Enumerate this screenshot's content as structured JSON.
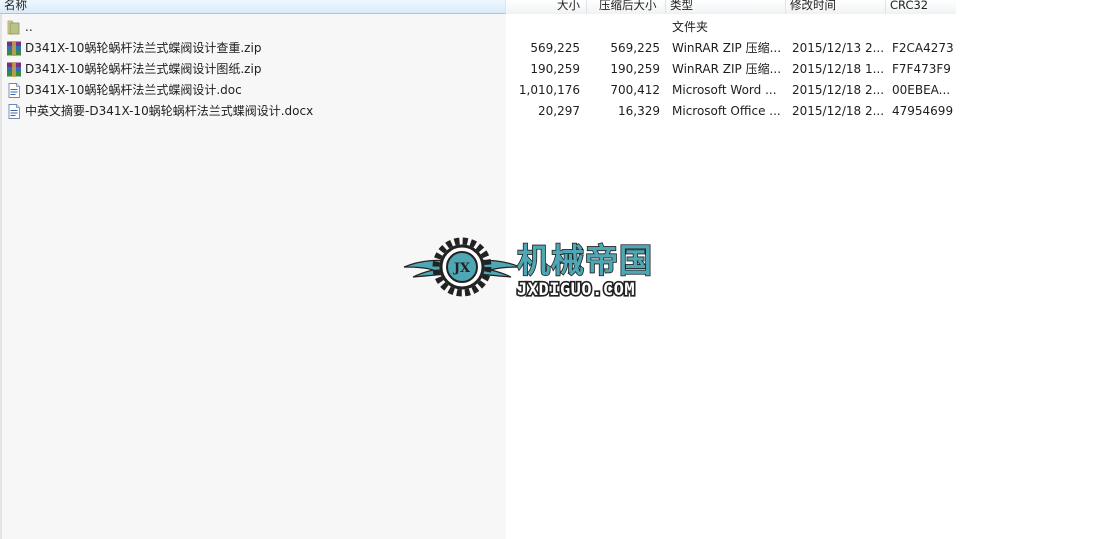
{
  "columns": {
    "name": "名称",
    "size": "大小",
    "packed": "压缩后大小",
    "type": "类型",
    "modified": "修改时间",
    "crc": "CRC32"
  },
  "rows": [
    {
      "icon": "folder-up-icon",
      "name": "..",
      "size": "",
      "packed": "",
      "type": "文件夹",
      "modified": "",
      "crc": ""
    },
    {
      "icon": "winrar-archive-icon",
      "name": "D341X-10蜗轮蜗杆法兰式蝶阀设计查重.zip",
      "size": "569,225",
      "packed": "569,225",
      "type": "WinRAR ZIP 压缩...",
      "modified": "2015/12/13 2...",
      "crc": "F2CA4273"
    },
    {
      "icon": "winrar-archive-icon",
      "name": "D341X-10蜗轮蜗杆法兰式蝶阀设计图纸.zip",
      "size": "190,259",
      "packed": "190,259",
      "type": "WinRAR ZIP 压缩...",
      "modified": "2015/12/18 1...",
      "crc": "F7F473F9"
    },
    {
      "icon": "word-document-icon",
      "name": "D341X-10蜗轮蜗杆法兰式蝶阀设计.doc",
      "size": "1,010,176",
      "packed": "700,412",
      "type": "Microsoft Word ...",
      "modified": "2015/12/18 2...",
      "crc": "00EBEA..."
    },
    {
      "icon": "word-document-icon",
      "name": "中英文摘要-D341X-10蜗轮蜗杆法兰式蝶阀设计.docx",
      "size": "20,297",
      "packed": "16,329",
      "type": "Microsoft Office ...",
      "modified": "2015/12/18 2...",
      "crc": "47954699"
    }
  ],
  "watermark": {
    "title": "机械帝国",
    "url": "JXDIGUO.COM",
    "badge": "JX"
  },
  "colors": {
    "watermark_teal": "#4fa7b5",
    "watermark_dark": "#222222",
    "header_selected": "#d9ecf9"
  }
}
